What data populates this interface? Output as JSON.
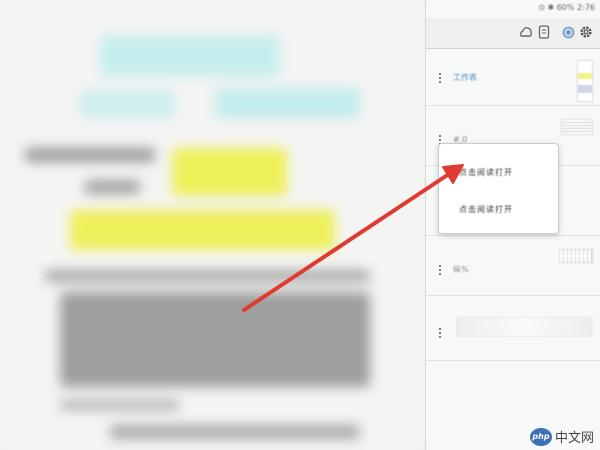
{
  "status_bar": {
    "text": "⊙ ✱ 60% 2:76"
  },
  "toolbar": {
    "icons": [
      "cloud-icon",
      "tablet-icon",
      "target-icon",
      "gear-icon"
    ]
  },
  "panel": {
    "rows": [
      {
        "label": "工作表",
        "label_style": "blue"
      },
      {
        "label": "#,0",
        "label_style": "gray"
      },
      {
        "label": "",
        "label_style": "gray"
      },
      {
        "label": "纵%",
        "label_style": "gray"
      },
      {
        "label": "",
        "label_style": "gray"
      }
    ]
  },
  "popup": {
    "items": [
      "点击阅读打开",
      "点击阅读打开"
    ]
  },
  "watermark": {
    "logo": "php",
    "text": "中文网"
  },
  "colors": {
    "arrow": "#e03b32",
    "highlight_yellow": "#eef05a",
    "highlight_cyan": "#c8eeee",
    "accent_blue": "#4a8fbf",
    "watermark_logo": "#3f6fb5"
  }
}
